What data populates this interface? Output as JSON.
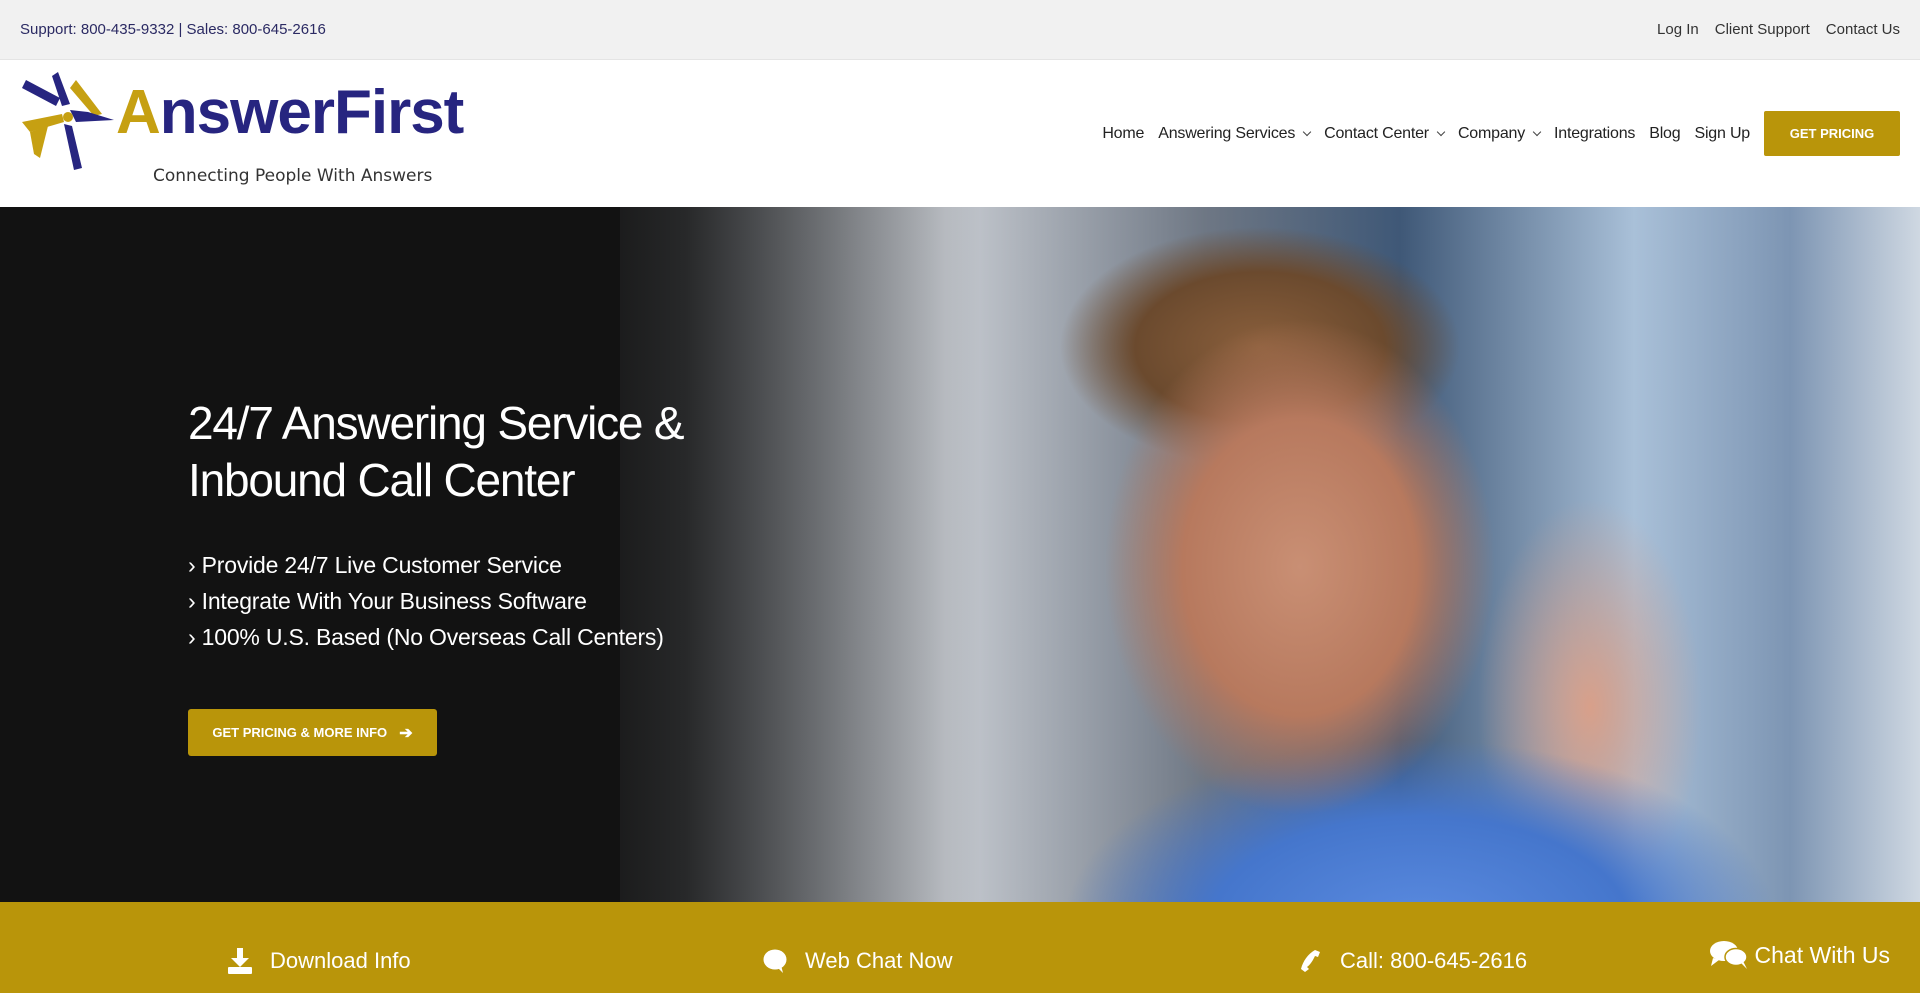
{
  "topbar": {
    "contact": "Support: 800-435-9332 | Sales: 800-645-2616",
    "links": [
      "Log In",
      "Client Support",
      "Contact Us"
    ]
  },
  "header": {
    "logo": {
      "brand_first": "A",
      "brand_rest": "nswerFirst",
      "tagline": "Connecting People With Answers"
    },
    "nav": [
      {
        "label": "Home",
        "dropdown": false
      },
      {
        "label": "Answering Services",
        "dropdown": true
      },
      {
        "label": "Contact Center",
        "dropdown": true
      },
      {
        "label": "Company",
        "dropdown": true
      },
      {
        "label": "Integrations",
        "dropdown": false
      },
      {
        "label": "Blog",
        "dropdown": false
      },
      {
        "label": "Sign Up",
        "dropdown": false
      }
    ],
    "cta": "GET PRICING"
  },
  "hero": {
    "title_line1": "24/7 Answering Service &",
    "title_line2": "Inbound Call Center",
    "bullets": [
      "› Provide 24/7 Live Customer Service",
      "› Integrate With Your Business Software",
      "› 100% U.S. Based (No Overseas Call Centers)"
    ],
    "button": "GET PRICING & MORE INFO",
    "button_icon": "arrow-right-icon",
    "image_alt": "smiling-agent-with-headset"
  },
  "ctabar": {
    "items": [
      {
        "label": "Download Info",
        "icon": "download-icon"
      },
      {
        "label": "Web Chat Now",
        "icon": "chat-bubble-icon"
      },
      {
        "label": "Call: 800-645-2616",
        "icon": "phone-icon"
      }
    ]
  },
  "chat_widget": {
    "label": "Chat With Us",
    "icon": "chat-bubbles-icon"
  },
  "colors": {
    "gold": "#b9950a",
    "navy": "#272580",
    "topbar_bg": "#f1f1f1",
    "hero_bg": "#121212"
  }
}
